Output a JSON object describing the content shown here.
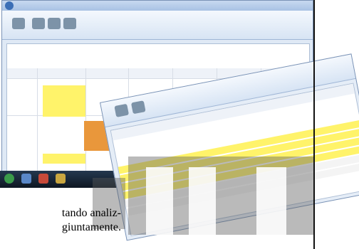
{
  "caption": {
    "line1": "tando analiz-",
    "line2": "giuntamente."
  },
  "icons": {
    "app_menu": "app-menu-orb-icon",
    "ribbon": [
      "ribbon-tool-icon",
      "ribbon-tool-icon",
      "ribbon-tool-icon",
      "ribbon-tool-icon"
    ],
    "taskbar": [
      "start-icon",
      "taskbar-app-icon",
      "taskbar-app-icon",
      "taskbar-app-icon"
    ]
  },
  "colors": {
    "window_chrome": "#dfe9f5",
    "highlight_yellow": "#fff36a",
    "highlight_green": "#57e05c",
    "highlight_orange": "#e9973b",
    "watermark": "#5a5a5a"
  }
}
